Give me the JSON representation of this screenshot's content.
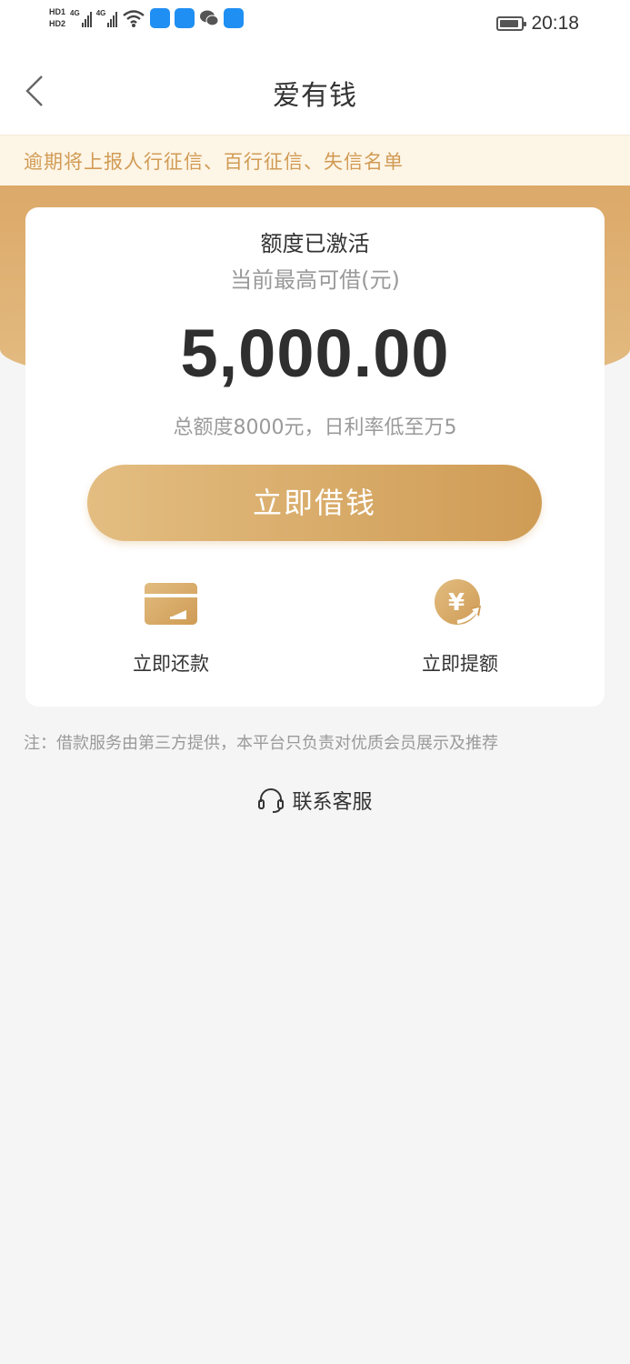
{
  "status_bar": {
    "hd1": "HD1",
    "hd2": "HD2",
    "network1": "4G",
    "network2": "4G",
    "time": "20:18"
  },
  "nav": {
    "title": "爱有钱"
  },
  "notice": {
    "text": "逾期将上报人行征信、百行征信、失信名单"
  },
  "card": {
    "status": "额度已激活",
    "subtitle": "当前最高可借(元)",
    "amount": "5,000.00",
    "info": "总额度8000元，日利率低至万5",
    "borrow_label": "立即借钱",
    "actions": [
      {
        "label": "立即还款",
        "icon": "card-icon"
      },
      {
        "label": "立即提额",
        "icon": "yuan-up-icon"
      }
    ]
  },
  "footnote": "注：借款服务由第三方提供，本平台只负责对优质会员展示及推荐",
  "service": {
    "label": "联系客服",
    "icon": "headset-icon"
  },
  "colors": {
    "gold": "#dca969",
    "gold_dark": "#cf9c55",
    "notice_text": "#d19b55",
    "notice_bg": "#fdf5e6",
    "background": "#f5f5f5"
  }
}
